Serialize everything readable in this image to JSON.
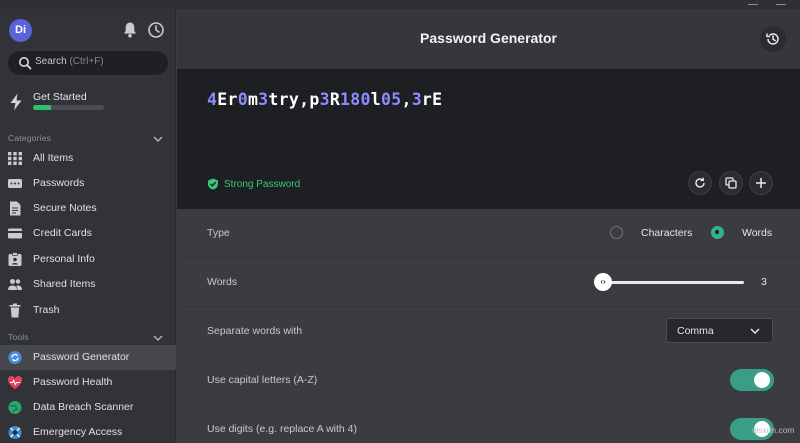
{
  "sidebar": {
    "avatar_initials": "Di",
    "search": {
      "label": "Search",
      "shortcut": "(Ctrl+F)"
    },
    "get_started": {
      "label": "Get Started",
      "progress_fraction": 0.25
    },
    "categories": {
      "heading": "Categories",
      "items": [
        {
          "label": "All Items",
          "icon": "grid-icon"
        },
        {
          "label": "Passwords",
          "icon": "password-card-icon"
        },
        {
          "label": "Secure Notes",
          "icon": "note-icon"
        },
        {
          "label": "Credit Cards",
          "icon": "credit-card-icon"
        },
        {
          "label": "Personal Info",
          "icon": "id-card-icon"
        },
        {
          "label": "Shared Items",
          "icon": "people-icon"
        },
        {
          "label": "Trash",
          "icon": "trash-icon"
        }
      ]
    },
    "tools": {
      "heading": "Tools",
      "items": [
        {
          "label": "Password Generator",
          "icon": "generator-icon",
          "active": true
        },
        {
          "label": "Password Health",
          "icon": "heart-pulse-icon"
        },
        {
          "label": "Data Breach Scanner",
          "icon": "globe-icon"
        },
        {
          "label": "Emergency Access",
          "icon": "lifebuoy-icon"
        }
      ]
    }
  },
  "main": {
    "title": "Password Generator",
    "password_segments": [
      {
        "t": "4",
        "digit": true
      },
      {
        "t": "Er",
        "digit": false
      },
      {
        "t": "0",
        "digit": true
      },
      {
        "t": "m",
        "digit": false
      },
      {
        "t": "3",
        "digit": true
      },
      {
        "t": "try,p",
        "digit": false
      },
      {
        "t": "3",
        "digit": true
      },
      {
        "t": "R",
        "digit": false
      },
      {
        "t": "180",
        "digit": true
      },
      {
        "t": "l",
        "digit": false
      },
      {
        "t": "05",
        "digit": true
      },
      {
        "t": ",",
        "digit": false
      },
      {
        "t": "3",
        "digit": true
      },
      {
        "t": "rE",
        "digit": false
      }
    ],
    "strength": "Strong Password",
    "type": {
      "label": "Type",
      "option_characters": "Characters",
      "option_words": "Words",
      "selected": "Words"
    },
    "words": {
      "label": "Words",
      "value": "3"
    },
    "separator": {
      "label": "Separate words with",
      "value": "Comma"
    },
    "capitals": {
      "label": "Use capital letters (A-Z)",
      "on": true
    },
    "digits": {
      "label": "Use digits (e.g. replace A with 4)",
      "on": true
    }
  },
  "watermark": "wsxdn.com",
  "colors": {
    "accent": "#3a9d86",
    "strong": "#3ec47c",
    "digit": "#8c8cff",
    "brand": "#5b63d6"
  }
}
